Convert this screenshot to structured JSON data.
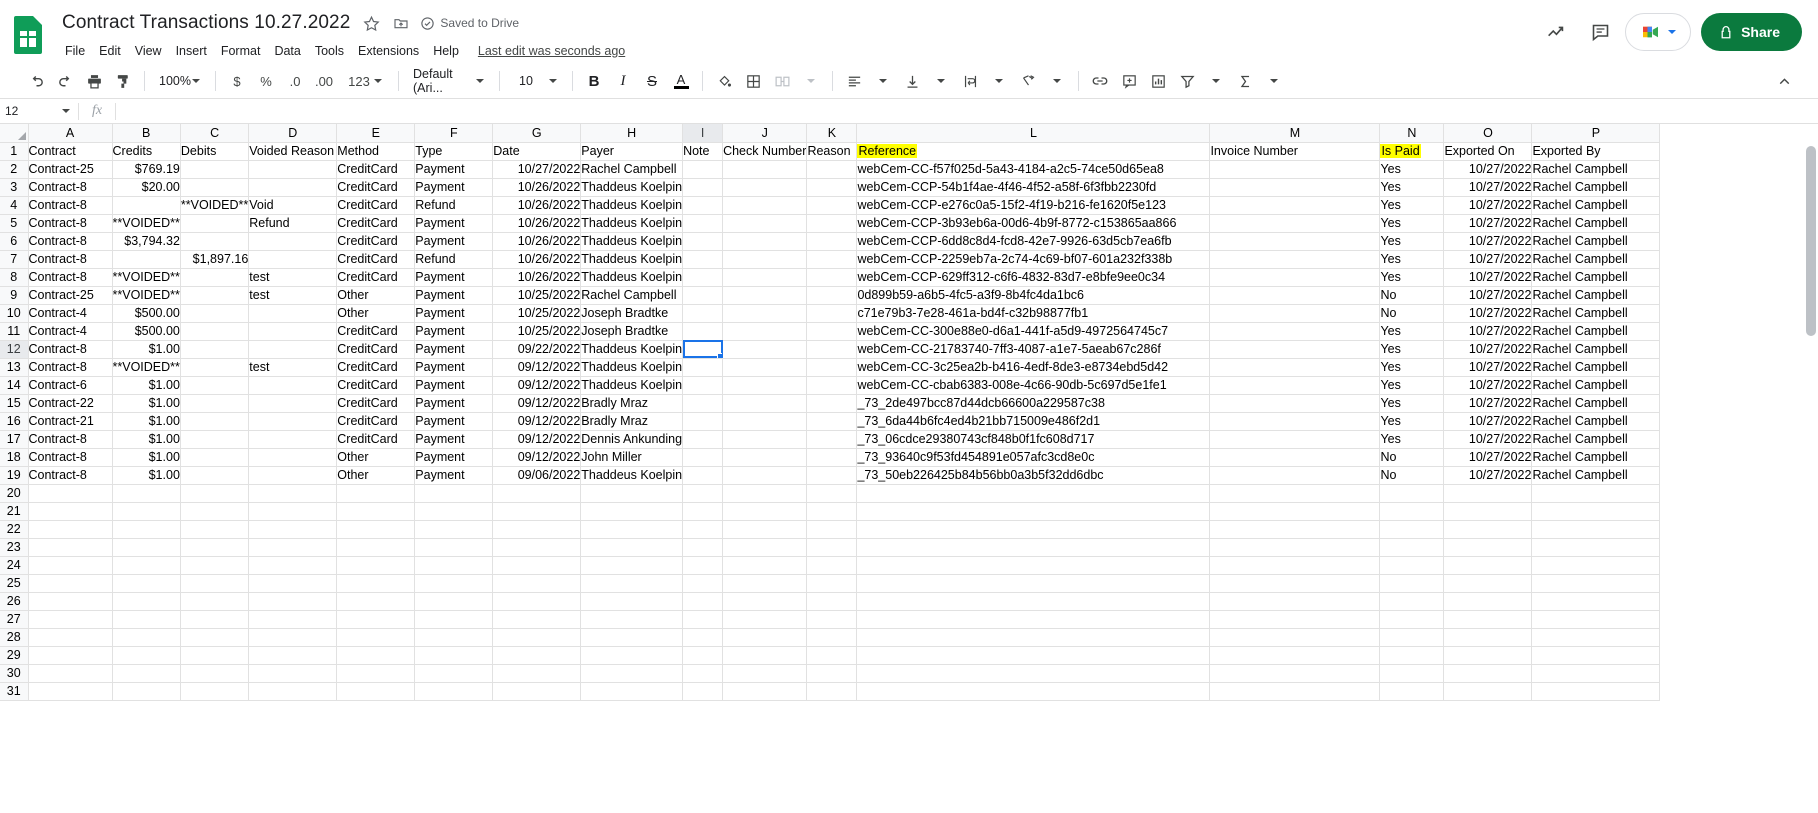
{
  "app": {
    "doc_title": "Contract Transactions 10.27.2022",
    "save_state": "Saved to Drive",
    "last_edit": "Last edit was seconds ago",
    "menus": [
      "File",
      "Edit",
      "View",
      "Insert",
      "Format",
      "Data",
      "Tools",
      "Extensions",
      "Help"
    ],
    "share_label": "Share",
    "accent_color": "#0b7a3e",
    "highlight_color": "#ffff00",
    "selection_color": "#1a73e8",
    "icons": {
      "sheets_logo": "google-sheets-logo",
      "star": "star-icon",
      "move_to_folder": "move-to-folder-icon",
      "cloud_saved": "cloud-check-icon",
      "trends": "trends-icon",
      "comment": "comment-icon",
      "meet": "google-meet-icon",
      "lock": "lock-icon"
    }
  },
  "toolbar": {
    "undo": "undo-icon",
    "redo": "redo-icon",
    "print": "print-icon",
    "paint_format": "paint-format-icon",
    "zoom_value": "100%",
    "currency": "$",
    "percent": "%",
    "decrease_decimal": ".0",
    "increase_decimal": ".00",
    "more_formats": "123",
    "font_value": "Default (Ari...",
    "font_size_value": "10",
    "bold": "B",
    "italic": "I",
    "strikethrough": "S",
    "text_color": "A",
    "fill_color": "fill-color-icon",
    "borders": "borders-icon",
    "merge_cells": "merge-cells-icon",
    "horizontal_align": "horizontal-align-icon",
    "vertical_align": "vertical-align-icon",
    "text_wrapping": "text-wrapping-icon",
    "text_rotation": "text-rotation-icon",
    "insert_link": "link-icon",
    "insert_comment": "add-comment-icon",
    "insert_chart": "insert-chart-icon",
    "create_filter": "filter-icon",
    "functions": "functions-sigma-icon",
    "collapse": "chevron-up-icon"
  },
  "formula_bar": {
    "name_box": "12",
    "fx": "fx",
    "value": ""
  },
  "grid": {
    "column_letters": [
      "A",
      "B",
      "C",
      "D",
      "E",
      "F",
      "G",
      "H",
      "I",
      "J",
      "K",
      "L",
      "M",
      "N",
      "O",
      "P"
    ],
    "selected_column": "I",
    "selected_row": "12",
    "selected_cell": "I12",
    "row_numbers": [
      "1",
      "2",
      "3",
      "4",
      "5",
      "6",
      "7",
      "8",
      "9",
      "10",
      "11",
      "12",
      "13",
      "14",
      "15",
      "16",
      "17",
      "18",
      "19",
      "20",
      "21",
      "22",
      "23",
      "24",
      "25",
      "26",
      "27",
      "28",
      "29",
      "30",
      "31"
    ],
    "headers": [
      "Contract",
      "Credits",
      "Debits",
      "Voided Reason",
      "Method",
      "Type",
      "Date",
      "Payer",
      "Note",
      "Check Number",
      "Reason",
      "Reference",
      "Invoice Number",
      "Is Paid",
      "Exported On",
      "Exported By"
    ],
    "highlighted_headers": [
      "Reference",
      "Is Paid"
    ],
    "rows": [
      [
        "Contract-25",
        "$769.19",
        "",
        "",
        "CreditCard",
        "Payment",
        "10/27/2022",
        "Rachel Campbell",
        "",
        "",
        "",
        "webCem-CC-f57f025d-5a43-4184-a2c5-74ce50d65ea8",
        "",
        "Yes",
        "10/27/2022",
        "Rachel Campbell"
      ],
      [
        "Contract-8",
        "$20.00",
        "",
        "",
        "CreditCard",
        "Payment",
        "10/26/2022",
        "Thaddeus Koelpin",
        "",
        "",
        "",
        "webCem-CCP-54b1f4ae-4f46-4f52-a58f-6f3fbb2230fd",
        "",
        "Yes",
        "10/27/2022",
        "Rachel Campbell"
      ],
      [
        "Contract-8",
        "",
        "**VOIDED**",
        "Void",
        "CreditCard",
        "Refund",
        "10/26/2022",
        "Thaddeus Koelpin",
        "",
        "",
        "",
        "webCem-CCP-e276c0a5-15f2-4f19-b216-fe1620f5e123",
        "",
        "Yes",
        "10/27/2022",
        "Rachel Campbell"
      ],
      [
        "Contract-8",
        "**VOIDED**",
        "",
        "Refund",
        "CreditCard",
        "Payment",
        "10/26/2022",
        "Thaddeus Koelpin",
        "",
        "",
        "",
        "webCem-CCP-3b93eb6a-00d6-4b9f-8772-c153865aa866",
        "",
        "Yes",
        "10/27/2022",
        "Rachel Campbell"
      ],
      [
        "Contract-8",
        "$3,794.32",
        "",
        "",
        "CreditCard",
        "Payment",
        "10/26/2022",
        "Thaddeus Koelpin",
        "",
        "",
        "",
        "webCem-CCP-6dd8c8d4-fcd8-42e7-9926-63d5cb7ea6fb",
        "",
        "Yes",
        "10/27/2022",
        "Rachel Campbell"
      ],
      [
        "Contract-8",
        "",
        "$1,897.16",
        "",
        "CreditCard",
        "Refund",
        "10/26/2022",
        "Thaddeus Koelpin",
        "",
        "",
        "",
        "webCem-CCP-2259eb7a-2c74-4c69-bf07-601a232f338b",
        "",
        "Yes",
        "10/27/2022",
        "Rachel Campbell"
      ],
      [
        "Contract-8",
        "**VOIDED**",
        "",
        "test",
        "CreditCard",
        "Payment",
        "10/26/2022",
        "Thaddeus Koelpin",
        "",
        "",
        "",
        "webCem-CCP-629ff312-c6f6-4832-83d7-e8bfe9ee0c34",
        "",
        "Yes",
        "10/27/2022",
        "Rachel Campbell"
      ],
      [
        "Contract-25",
        "**VOIDED**",
        "",
        "test",
        "Other",
        "Payment",
        "10/25/2022",
        "Rachel Campbell",
        "",
        "",
        "",
        "0d899b59-a6b5-4fc5-a3f9-8b4fc4da1bc6",
        "",
        "No",
        "10/27/2022",
        "Rachel Campbell"
      ],
      [
        "Contract-4",
        "$500.00",
        "",
        "",
        "Other",
        "Payment",
        "10/25/2022",
        "Joseph Bradtke",
        "",
        "",
        "",
        "c71e79b3-7e28-461a-bd4f-c32b98877fb1",
        "",
        "No",
        "10/27/2022",
        "Rachel Campbell"
      ],
      [
        "Contract-4",
        "$500.00",
        "",
        "",
        "CreditCard",
        "Payment",
        "10/25/2022",
        "Joseph Bradtke",
        "",
        "",
        "",
        "webCem-CC-300e88e0-d6a1-441f-a5d9-4972564745c7",
        "",
        "Yes",
        "10/27/2022",
        "Rachel Campbell"
      ],
      [
        "Contract-8",
        "$1.00",
        "",
        "",
        "CreditCard",
        "Payment",
        "09/22/2022",
        "Thaddeus Koelpin",
        "",
        "",
        "",
        "webCem-CC-21783740-7ff3-4087-a1e7-5aeab67c286f",
        "",
        "Yes",
        "10/27/2022",
        "Rachel Campbell"
      ],
      [
        "Contract-8",
        "**VOIDED**",
        "",
        "test",
        "CreditCard",
        "Payment",
        "09/12/2022",
        "Thaddeus Koelpin",
        "",
        "",
        "",
        "webCem-CC-3c25ea2b-b416-4edf-8de3-e8734ebd5d42",
        "",
        "Yes",
        "10/27/2022",
        "Rachel Campbell"
      ],
      [
        "Contract-6",
        "$1.00",
        "",
        "",
        "CreditCard",
        "Payment",
        "09/12/2022",
        "Thaddeus Koelpin",
        "",
        "",
        "",
        "webCem-CC-cbab6383-008e-4c66-90db-5c697d5e1fe1",
        "",
        "Yes",
        "10/27/2022",
        "Rachel Campbell"
      ],
      [
        "Contract-22",
        "$1.00",
        "",
        "",
        "CreditCard",
        "Payment",
        "09/12/2022",
        "Bradly Mraz",
        "",
        "",
        "",
        "_73_2de497bcc87d44dcb66600a229587c38",
        "",
        "Yes",
        "10/27/2022",
        "Rachel Campbell"
      ],
      [
        "Contract-21",
        "$1.00",
        "",
        "",
        "CreditCard",
        "Payment",
        "09/12/2022",
        "Bradly Mraz",
        "",
        "",
        "",
        "_73_6da44b6fc4ed4b21bb715009e486f2d1",
        "",
        "Yes",
        "10/27/2022",
        "Rachel Campbell"
      ],
      [
        "Contract-8",
        "$1.00",
        "",
        "",
        "CreditCard",
        "Payment",
        "09/12/2022",
        "Dennis Ankunding",
        "",
        "",
        "",
        "_73_06cdce29380743cf848b0f1fc608d717",
        "",
        "Yes",
        "10/27/2022",
        "Rachel Campbell"
      ],
      [
        "Contract-8",
        "$1.00",
        "",
        "",
        "Other",
        "Payment",
        "09/12/2022",
        "John Miller",
        "",
        "",
        "",
        "_73_93640c9f53fd454891e057afc3cd8e0c",
        "",
        "No",
        "10/27/2022",
        "Rachel Campbell"
      ],
      [
        "Contract-8",
        "$1.00",
        "",
        "",
        "Other",
        "Payment",
        "09/06/2022",
        "Thaddeus Koelpin",
        "",
        "",
        "",
        "_73_50eb226425b84b56bb0a3b5f32dd6dbc",
        "",
        "No",
        "10/27/2022",
        "Rachel Campbell"
      ]
    ]
  }
}
